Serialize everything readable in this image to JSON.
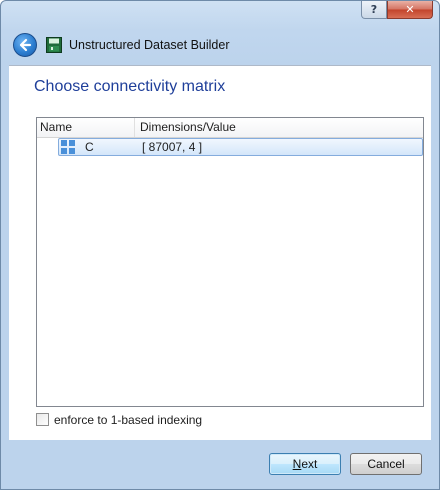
{
  "titlebar": {
    "help_label": "?",
    "close_label": "✕"
  },
  "header": {
    "window_title": "Unstructured Dataset Builder",
    "back_icon": "back-arrow-icon",
    "app_icon": "dataset-builder-icon"
  },
  "main": {
    "heading": "Choose connectivity matrix",
    "table": {
      "columns": [
        "Name",
        "Dimensions/Value"
      ],
      "rows": [
        {
          "name": "C",
          "value": "[ 87007, 4 ]",
          "icon": "matrix-icon",
          "selected": true
        }
      ]
    },
    "checkbox": {
      "label": "enforce to 1-based indexing",
      "checked": false
    }
  },
  "footer": {
    "next_mnemonic": "N",
    "next_rest": "ext",
    "cancel_label": "Cancel"
  },
  "colors": {
    "heading": "#1f3f9a",
    "selection_border": "#84acdd",
    "accent": "#2d7fd1"
  }
}
